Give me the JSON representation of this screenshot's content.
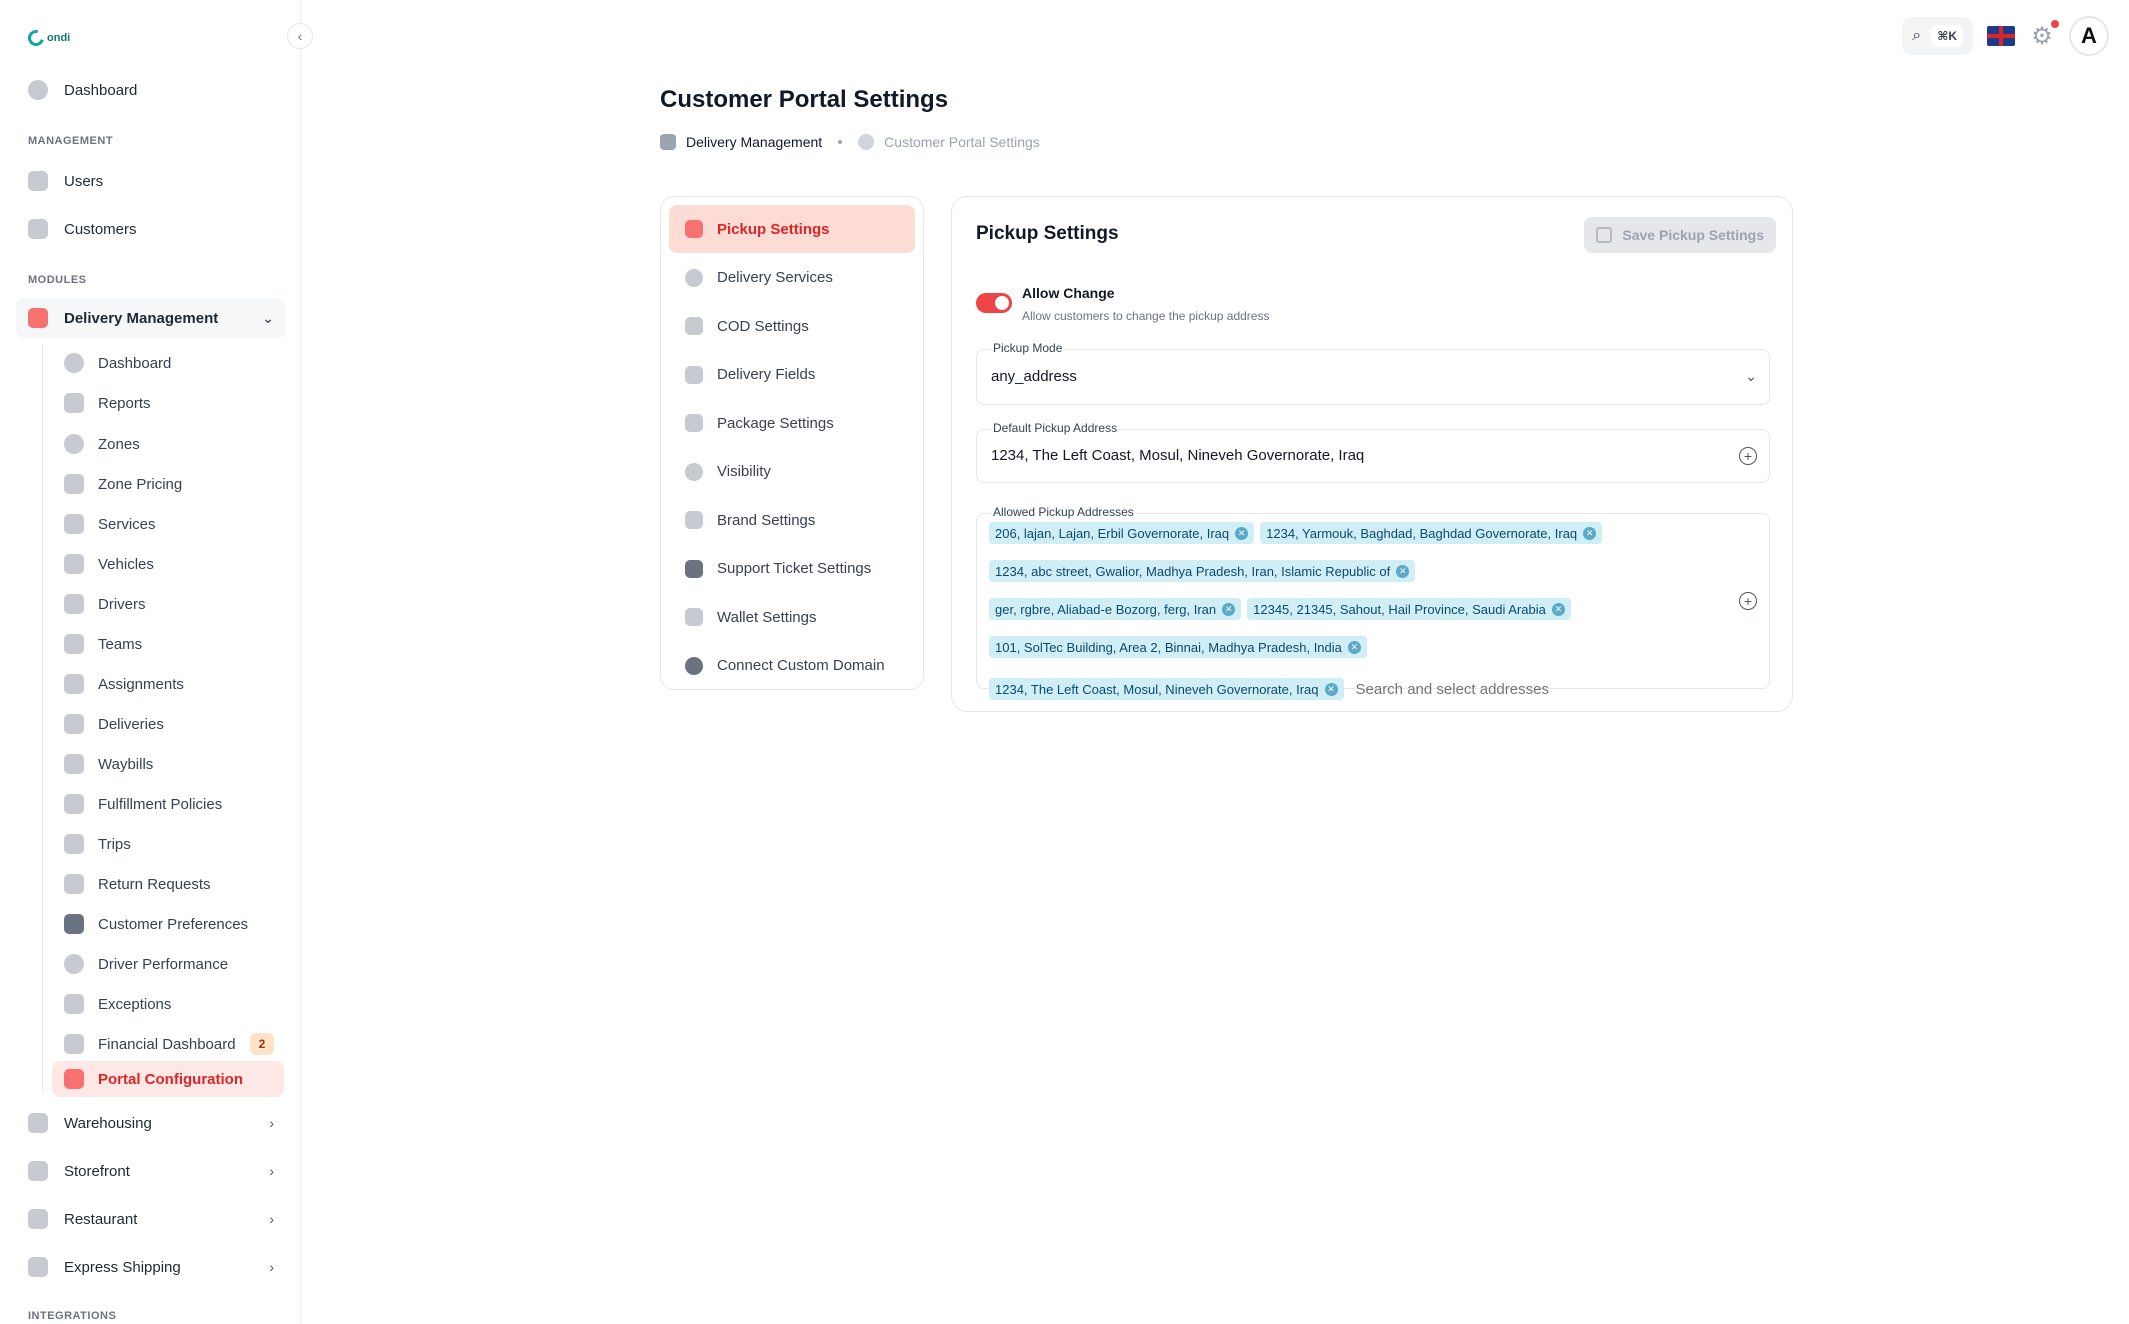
{
  "logo": {
    "text": "ondi"
  },
  "sidebar": {
    "top_items": [
      {
        "label": "Dashboard",
        "icon": "dashboard-icon"
      }
    ],
    "management_label": "MANAGEMENT",
    "management_items": [
      {
        "label": "Users",
        "icon": "user-icon"
      },
      {
        "label": "Customers",
        "icon": "customers-icon"
      }
    ],
    "modules_label": "MODULES",
    "delivery_management": {
      "label": "Delivery Management",
      "icon": "truck-icon"
    },
    "sub_items": [
      {
        "label": "Dashboard",
        "icon": "dashboard-icon"
      },
      {
        "label": "Reports",
        "icon": "chart-icon"
      },
      {
        "label": "Zones",
        "icon": "map-pin-icon"
      },
      {
        "label": "Zone Pricing",
        "icon": "dollar-icon"
      },
      {
        "label": "Services",
        "icon": "services-icon"
      },
      {
        "label": "Vehicles",
        "icon": "scooter-icon"
      },
      {
        "label": "Drivers",
        "icon": "drivers-icon"
      },
      {
        "label": "Teams",
        "icon": "teams-icon"
      },
      {
        "label": "Assignments",
        "icon": "assignments-icon"
      },
      {
        "label": "Deliveries",
        "icon": "deliveries-icon"
      },
      {
        "label": "Waybills",
        "icon": "waybill-icon"
      },
      {
        "label": "Fulfillment Policies",
        "icon": "policy-icon"
      },
      {
        "label": "Trips",
        "icon": "trips-icon"
      },
      {
        "label": "Return Requests",
        "icon": "return-icon"
      },
      {
        "label": "Customer Preferences",
        "icon": "sliders-icon"
      },
      {
        "label": "Driver Performance",
        "icon": "gauge-icon"
      },
      {
        "label": "Exceptions",
        "icon": "warning-icon"
      },
      {
        "label": "Financial Dashboard",
        "icon": "finance-icon",
        "badge": "2"
      },
      {
        "label": "Portal Configuration",
        "icon": "wrench-icon",
        "active": true
      }
    ],
    "collapsed_modules": [
      {
        "label": "Warehousing",
        "icon": "warehouse-icon"
      },
      {
        "label": "Storefront",
        "icon": "storefront-icon"
      },
      {
        "label": "Restaurant",
        "icon": "restaurant-icon"
      },
      {
        "label": "Express Shipping",
        "icon": "express-icon"
      }
    ],
    "integrations_label": "INTEGRATIONS"
  },
  "topbar": {
    "shortcut": "⌘K",
    "avatar_letter": "A"
  },
  "page": {
    "title": "Customer Portal Settings",
    "breadcrumb": [
      "Delivery Management",
      "Customer Portal Settings"
    ]
  },
  "settings_menu": [
    {
      "label": "Pickup Settings",
      "icon": "truck-icon",
      "active": true
    },
    {
      "label": "Delivery Services",
      "icon": "globe-icon"
    },
    {
      "label": "COD Settings",
      "icon": "cash-icon"
    },
    {
      "label": "Delivery Fields",
      "icon": "fields-icon"
    },
    {
      "label": "Package Settings",
      "icon": "package-icon"
    },
    {
      "label": "Visibility",
      "icon": "eye-icon"
    },
    {
      "label": "Brand Settings",
      "icon": "brush-icon"
    },
    {
      "label": "Support Ticket Settings",
      "icon": "ticket-icon"
    },
    {
      "label": "Wallet Settings",
      "icon": "wallet-icon"
    },
    {
      "label": "Connect Custom Domain",
      "icon": "domain-icon"
    }
  ],
  "pickup": {
    "title": "Pickup Settings",
    "save_label": "Save Pickup Settings",
    "allow_change": {
      "label": "Allow Change",
      "help": "Allow customers to change the pickup address",
      "enabled": true
    },
    "pickup_mode": {
      "label": "Pickup Mode",
      "value": "any_address"
    },
    "default_address": {
      "label": "Default Pickup Address",
      "value": "1234, The Left Coast, Mosul, Nineveh Governorate, Iraq"
    },
    "allowed_addresses": {
      "label": "Allowed Pickup Addresses",
      "chips": [
        "206, lajan, Lajan, Erbil Governorate, Iraq",
        "1234, Yarmouk, Baghdad, Baghdad Governorate, Iraq",
        "1234, abc street, Gwalior, Madhya Pradesh, Iran, Islamic Republic of",
        "ger, rgbre, Aliabad-e Bozorg, ferg, Iran",
        "12345, 21345, Sahout, Hail Province, Saudi Arabia",
        "101, SolTec Building, Area 2, Binnai, Madhya Pradesh, India",
        "1234, The Left Coast, Mosul, Nineveh Governorate, Iraq"
      ],
      "placeholder": "Search and select addresses"
    }
  },
  "colors": {
    "accent": "#ef4444",
    "active_bg": "#fde8e6",
    "chip_bg": "#cfeef5"
  }
}
